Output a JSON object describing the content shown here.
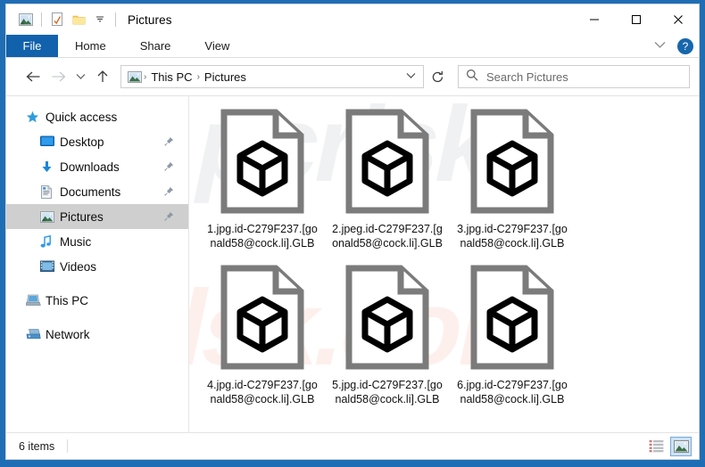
{
  "window": {
    "title": "Pictures",
    "minimize_label": "—",
    "maximize_label": "☐",
    "close_label": "✕"
  },
  "quick_access_toolbar": {
    "items": [
      {
        "icon": "picture-icon",
        "name": "pictures-folder-icon"
      },
      {
        "icon": "properties-icon",
        "name": "properties-icon"
      },
      {
        "icon": "new-folder-icon",
        "name": "new-folder-icon"
      },
      {
        "icon": "chevron-down-icon",
        "name": "customize-qat-icon"
      }
    ]
  },
  "ribbon": {
    "file_tab": "File",
    "tabs": [
      "Home",
      "Share",
      "View"
    ],
    "expand_label": "∨",
    "help_label": "?"
  },
  "address_bar": {
    "back_label": "←",
    "forward_label": "→",
    "recent_label": "∨",
    "up_label": "↑",
    "breadcrumbs": [
      "This PC",
      "Pictures"
    ],
    "crumb_separator": "›",
    "dropdown_label": "∨",
    "refresh_label": "↻"
  },
  "search": {
    "placeholder": "Search Pictures",
    "icon": "search-icon",
    "value": ""
  },
  "sidebar": {
    "items": [
      {
        "label": "Quick access",
        "icon": "star-icon",
        "indent": false,
        "pinned": false,
        "selected": false
      },
      {
        "label": "Desktop",
        "icon": "desktop-icon",
        "indent": true,
        "pinned": true,
        "selected": false
      },
      {
        "label": "Downloads",
        "icon": "downloads-icon",
        "indent": true,
        "pinned": true,
        "selected": false
      },
      {
        "label": "Documents",
        "icon": "documents-icon",
        "indent": true,
        "pinned": true,
        "selected": false
      },
      {
        "label": "Pictures",
        "icon": "pictures-icon",
        "indent": true,
        "pinned": true,
        "selected": true
      },
      {
        "label": "Music",
        "icon": "music-icon",
        "indent": true,
        "pinned": false,
        "selected": false
      },
      {
        "label": "Videos",
        "icon": "videos-icon",
        "indent": true,
        "pinned": false,
        "selected": false
      },
      {
        "label": "This PC",
        "icon": "this-pc-icon",
        "indent": false,
        "pinned": false,
        "selected": false,
        "gap_before": true
      },
      {
        "label": "Network",
        "icon": "network-icon",
        "indent": false,
        "pinned": false,
        "selected": false,
        "gap_before": true
      }
    ]
  },
  "files": [
    {
      "name": "1.jpg.id-C279F237.[gonald58@cock.li].GLB",
      "icon": "glb-file-icon"
    },
    {
      "name": "2.jpeg.id-C279F237.[gonald58@cock.li].GLB",
      "icon": "glb-file-icon"
    },
    {
      "name": "3.jpg.id-C279F237.[gonald58@cock.li].GLB",
      "icon": "glb-file-icon"
    },
    {
      "name": "4.jpg.id-C279F237.[gonald58@cock.li].GLB",
      "icon": "glb-file-icon"
    },
    {
      "name": "5.jpg.id-C279F237.[gonald58@cock.li].GLB",
      "icon": "glb-file-icon"
    },
    {
      "name": "6.jpg.id-C279F237.[gonald58@cock.li].GLB",
      "icon": "glb-file-icon"
    }
  ],
  "watermark": {
    "line1": "pcrisk",
    "line2": "rlsk.com"
  },
  "status_bar": {
    "item_count": "6 items",
    "details_view_icon": "details-view-icon",
    "large_icons_view_icon": "large-icons-view-icon"
  },
  "colors": {
    "frame_blue": "#1f6eb5",
    "file_tab_blue": "#1161ac",
    "selection_gray": "#cfcfcf",
    "accent_blue": "#1767ad"
  }
}
